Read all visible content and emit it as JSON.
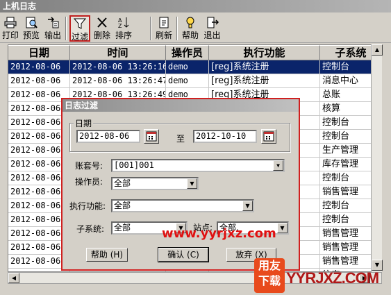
{
  "window": {
    "title": "上机日志"
  },
  "toolbar": {
    "buttons": [
      {
        "label": "打印",
        "icon": "printer-icon"
      },
      {
        "label": "预览",
        "icon": "preview-icon"
      },
      {
        "label": "输出",
        "icon": "export-icon"
      },
      {
        "label": "过滤",
        "icon": "filter-icon",
        "active": true
      },
      {
        "label": "删除",
        "icon": "delete-icon"
      },
      {
        "label": "排序",
        "icon": "sort-icon"
      },
      {
        "label": "刷新",
        "icon": "refresh-icon"
      },
      {
        "label": "帮助",
        "icon": "help-icon"
      },
      {
        "label": "退出",
        "icon": "exit-icon"
      }
    ]
  },
  "grid": {
    "columns": [
      "日期",
      "时间",
      "操作员",
      "执行功能",
      "子系统"
    ],
    "rows": [
      [
        "2012-08-06",
        "2012-08-06 13:26:16",
        "demo",
        "[reg]系统注册",
        "控制台"
      ],
      [
        "2012-08-06",
        "2012-08-06 13:26:47",
        "demo",
        "[reg]系统注册",
        "消息中心"
      ],
      [
        "2012-08-06",
        "2012-08-06 13:26:49",
        "demo",
        "[reg]系统注册",
        "总账"
      ],
      [
        "2012-08-06",
        "",
        "",
        "",
        "核算"
      ],
      [
        "2012-08-06",
        "",
        "",
        "",
        "控制台"
      ],
      [
        "2012-08-06",
        "",
        "",
        "",
        "控制台"
      ],
      [
        "2012-08-06",
        "",
        "",
        "",
        "生产管理"
      ],
      [
        "2012-08-06",
        "",
        "",
        "",
        "库存管理"
      ],
      [
        "2012-08-06",
        "",
        "",
        "",
        "控制台"
      ],
      [
        "2012-08-06",
        "",
        "",
        "",
        "销售管理"
      ],
      [
        "2012-08-06",
        "",
        "",
        "",
        "控制台"
      ],
      [
        "2012-08-06",
        "",
        "",
        "",
        "控制台"
      ],
      [
        "2012-08-06",
        "",
        "",
        "",
        "销售管理"
      ],
      [
        "2012-08-06",
        "",
        "",
        "",
        "销售管理"
      ],
      [
        "2012-08-06",
        "",
        "",
        "",
        "销售管理"
      ],
      [
        "2012-08-06",
        "",
        "",
        "",
        "往来"
      ]
    ],
    "selected_row": 0
  },
  "dialog": {
    "title": "日志过滤",
    "date_group_label": "日期",
    "date_from": "2012-08-06",
    "date_to_label": "至",
    "date_to": "2012-10-10",
    "account_label": "账套号:",
    "account_value": "[001]001",
    "operator_label": "操作员:",
    "operator_value": "全部",
    "function_label": "执行功能:",
    "function_value": "全部",
    "subsystem_label": "子系统:",
    "subsystem_value": "全部",
    "station_label": "站点:",
    "station_value": "全部.",
    "help_button": "帮助 (H)",
    "ok_button": "确认 (C)",
    "cancel_button": "放弃 (X)"
  },
  "watermark": {
    "url": "www.yyrjxz.com",
    "badge_line1": "用友",
    "badge_line2": "下载",
    "big": "YYRJXZ.COM"
  },
  "colors": {
    "selection": "#0a246a",
    "highlight_border": "#d02020",
    "watermark": "#e01010"
  }
}
